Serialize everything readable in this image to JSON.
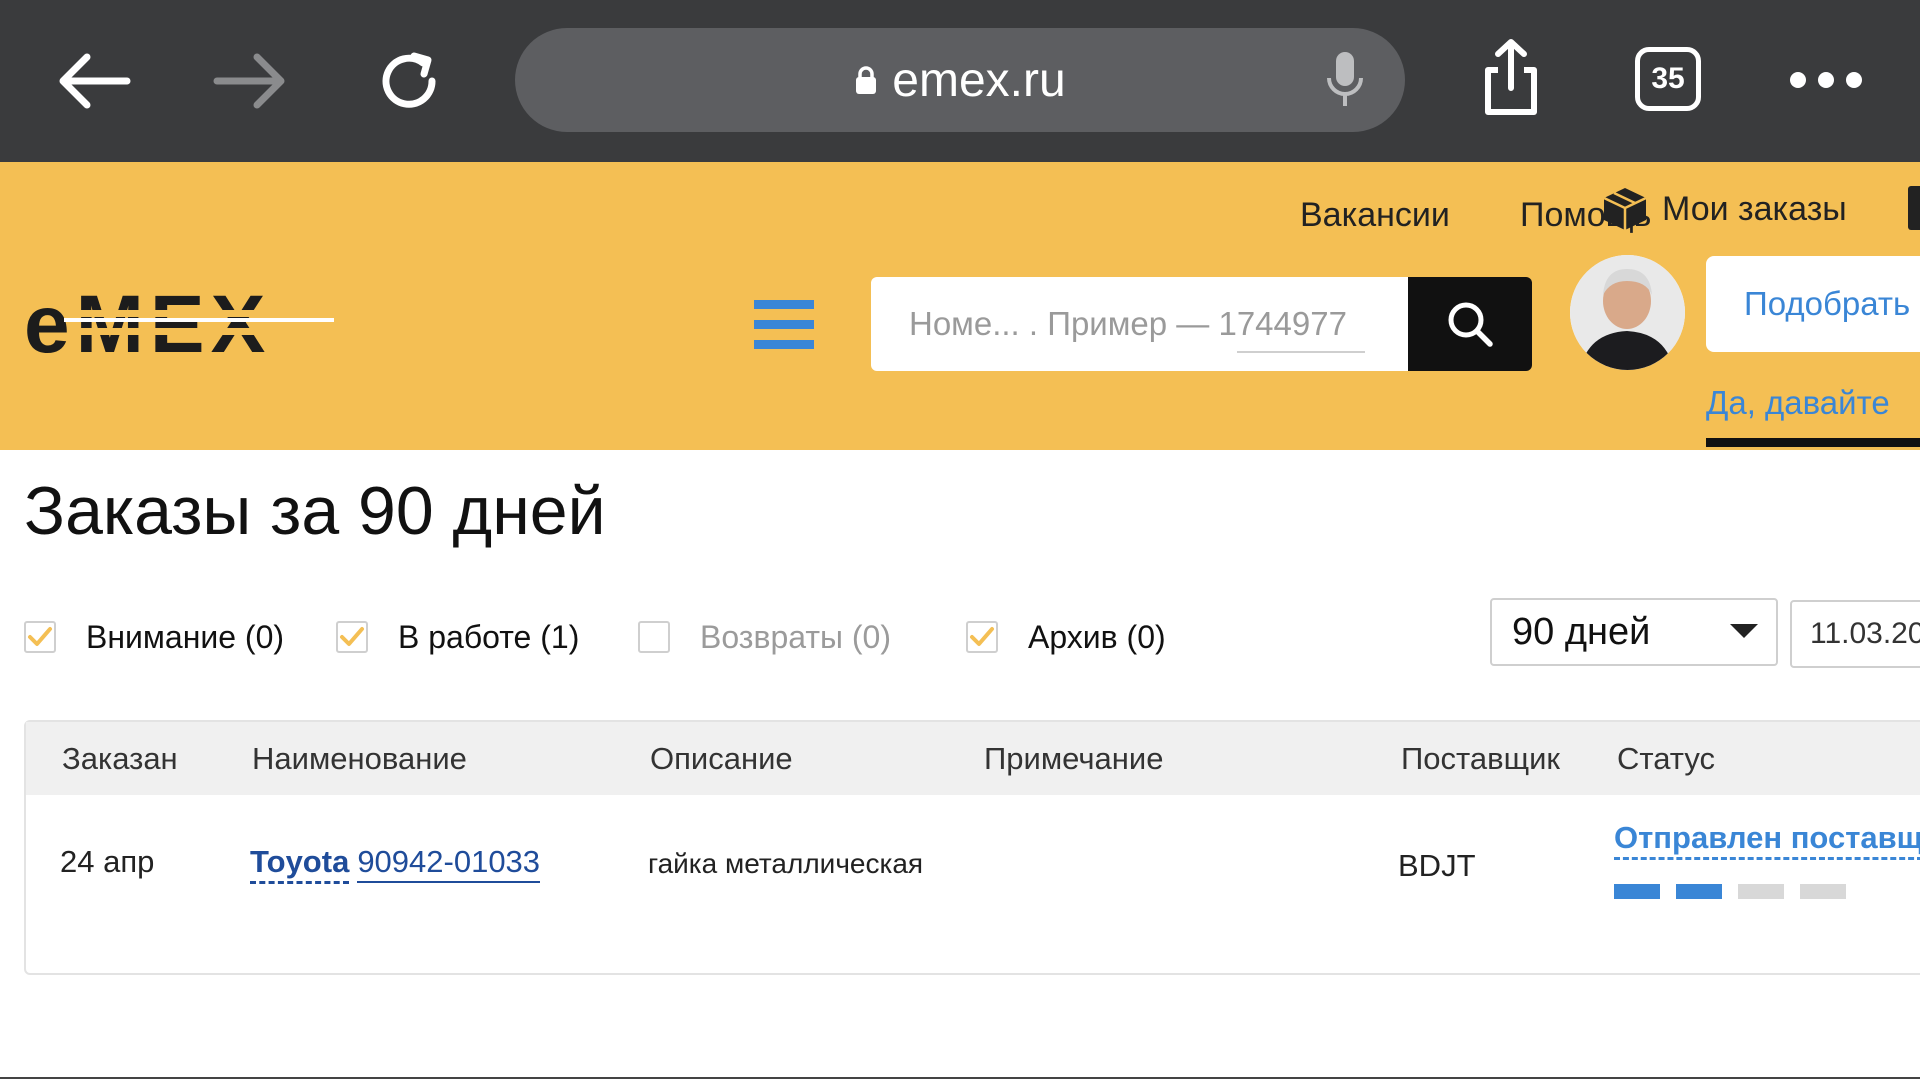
{
  "browser": {
    "url": "emex.ru",
    "tab_count": "35"
  },
  "header": {
    "links": [
      "Вакансии",
      "Помощь",
      "Мои заказы"
    ],
    "search_placeholder": "Номе... . Пример — 1744977",
    "pick_button": "Подобрать",
    "yes_link": "Да, давайте",
    "logo_text": "EMEX"
  },
  "page": {
    "title": "Заказы за 90 дней"
  },
  "filters": [
    {
      "label": "Внимание (0)",
      "checked": true
    },
    {
      "label": "В работе (1)",
      "checked": true
    },
    {
      "label": "Возвраты (0)",
      "checked": false
    },
    {
      "label": "Архив (0)",
      "checked": true
    }
  ],
  "period": {
    "selected": "90 дней",
    "date_from": "11.03.20"
  },
  "table": {
    "headers": [
      "Заказан",
      "Наименование",
      "Описание",
      "Примечание",
      "Поставщик",
      "Статус"
    ],
    "rows": [
      {
        "ordered": "24 апр",
        "brand": "Toyota",
        "part_number": "90942-01033",
        "description": "гайка металлическая",
        "note": "",
        "supplier": "BDJT",
        "status": "Отправлен поставщ",
        "progress_steps_done": 2,
        "progress_steps_total": 4
      }
    ]
  },
  "colors": {
    "header_bg": "#f4bf54",
    "chrome_bg": "#3a3b3d",
    "link_blue": "#3a86d6",
    "checkbox_accent": "#f4bf54"
  }
}
